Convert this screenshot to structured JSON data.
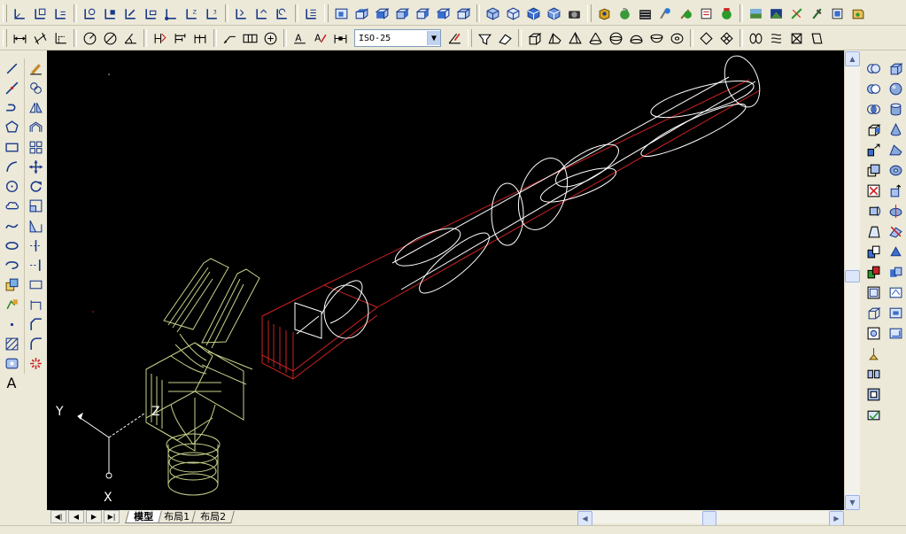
{
  "toolbar": {
    "dimstyle_value": "ISO-25"
  },
  "layout_tabs": [
    {
      "label": "模型",
      "active": true
    },
    {
      "label": "布局1",
      "active": false
    },
    {
      "label": "布局2",
      "active": false
    }
  ],
  "ucs": {
    "x_label": "X",
    "y_label": "Y",
    "z_label": "Z"
  },
  "text_tool_label": "A",
  "colors": {
    "canvas_bg": "#000000",
    "wire_white": "#ffffff",
    "wire_red": "#cc2222",
    "wire_olive": "#c8d28a",
    "toolbar_bg": "#ece9d8"
  },
  "icons": {
    "nav_first": "◀|",
    "nav_prev": "◀",
    "nav_next": "▶",
    "nav_last": "▶|",
    "scroll_up": "▲",
    "scroll_down": "▼",
    "scroll_left": "◀",
    "scroll_right": "▶",
    "combo_arrow": "▼"
  }
}
